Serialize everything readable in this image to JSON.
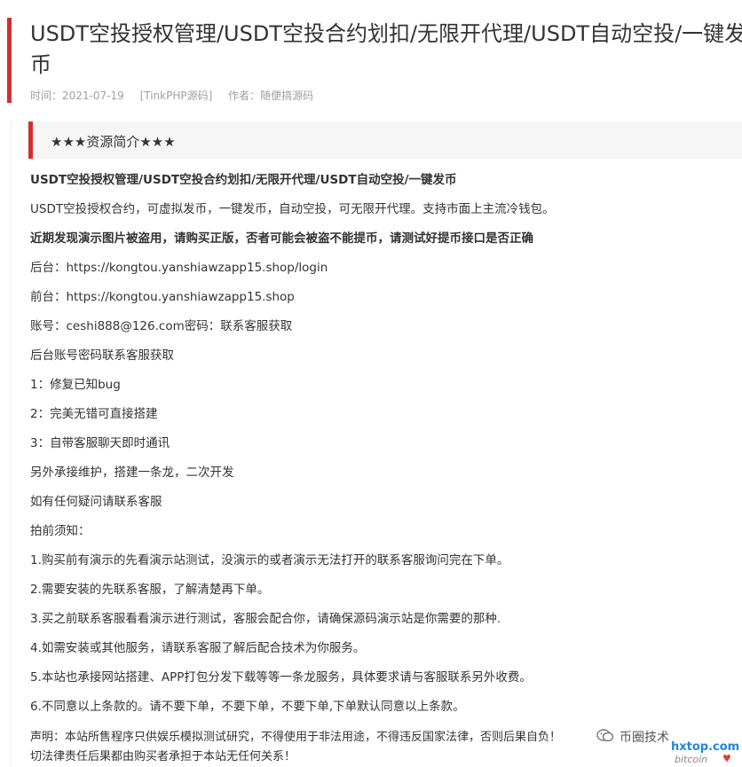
{
  "article": {
    "title_line1": "USDT空投授权管理/USDT空投合约划扣/无限开代理/USDT自动空投/一键发",
    "title_line2": "币",
    "meta": {
      "time": "时间：2021-07-19",
      "category": "[TinkPHP源码]",
      "author": "作者：随便搞源码"
    }
  },
  "section": {
    "title": "★★★资源简介★★★"
  },
  "paragraphs": [
    {
      "text": "USDT空投授权管理/USDT空投合约划扣/无限开代理/USDT自动空投/一键发币",
      "bold": true
    },
    {
      "text": "USDT空投授权合约，可虚拟发币，一键发币，自动空投，可无限开代理。支持市面上主流冷钱包。",
      "bold": false
    },
    {
      "text": "近期发现演示图片被盗用，请购买正版，否者可能会被盗不能提币，请测试好提币接口是否正确",
      "bold": true
    },
    {
      "text": "后台：https://kongtou.yanshiawzapp15.shop/login",
      "bold": false
    },
    {
      "text": "前台：https://kongtou.yanshiawzapp15.shop",
      "bold": false
    },
    {
      "text": "账号：ceshi888@126.com密码：联系客服获取",
      "bold": false
    },
    {
      "text": "后台账号密码联系客服获取",
      "bold": false
    },
    {
      "text": "1：修复已知bug",
      "bold": false
    },
    {
      "text": "2：完美无错可直接搭建",
      "bold": false
    },
    {
      "text": "3：自带客服聊天即时通讯",
      "bold": false
    },
    {
      "text": "另外承接维护，搭建一条龙，二次开发",
      "bold": false
    },
    {
      "text": "如有任何疑问请联系客服",
      "bold": false
    },
    {
      "text": "拍前须知：",
      "bold": false
    },
    {
      "text": "1.购买前有演示的先看演示站测试，没演示的或者演示无法打开的联系客服询问完在下单。",
      "bold": false
    },
    {
      "text": "2.需要安装的先联系客服，了解清楚再下单。",
      "bold": false
    },
    {
      "text": "3.买之前联系客服看看演示进行测试，客服会配合你，请确保源码演示站是你需要的那种.",
      "bold": false
    },
    {
      "text": "4.如需安装或其他服务，请联系客服了解后配合技术为你服务。",
      "bold": false
    },
    {
      "text": "5.本站也承接网站搭建、APP打包分发下载等等一条龙服务，具体要求请与客服联系另外收费。",
      "bold": false
    },
    {
      "text": "6.不同意以上条款的。请不要下单，不要下单，不要下单,下单默认同意以上条款。",
      "bold": false
    }
  ],
  "declaration": {
    "line1": "声明：本站所售程序只供娱乐模拟测试研究，不得使用于非法用途，不得违反国家法律，否则后果自负！",
    "line2": "切法律责任后果都由购买者承担于本站无任何关系！"
  },
  "watermark": {
    "icon": "wechat-icon",
    "text": "币圈技术",
    "site": "hxtop.com",
    "sub": "bitcoin"
  }
}
